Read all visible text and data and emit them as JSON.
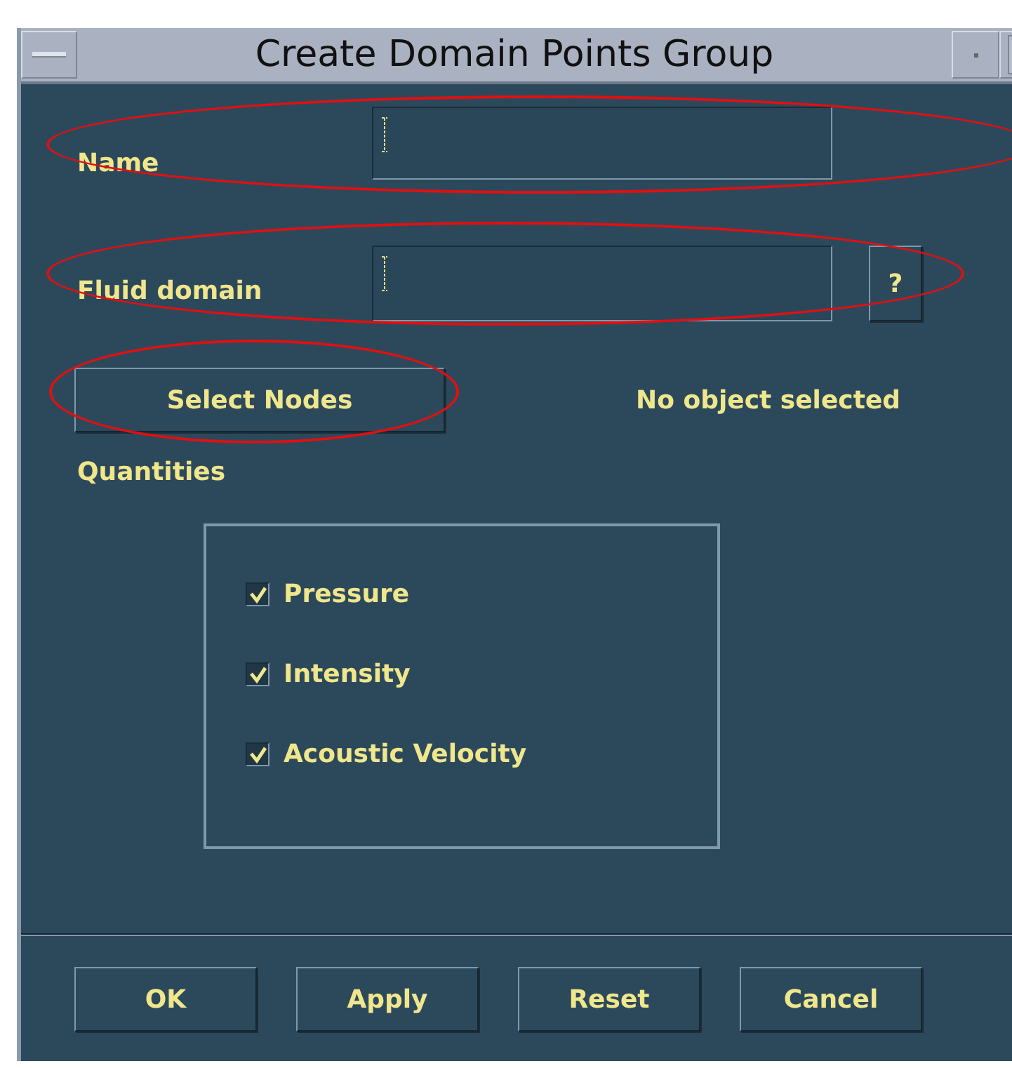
{
  "window": {
    "title": "Create Domain Points Group"
  },
  "name_field": {
    "label": "Name",
    "highlighted": true
  },
  "fluid_domain_field": {
    "label": "Fluid domain",
    "button": "?",
    "highlighted": true
  },
  "select_nodes": {
    "label": "Select Nodes",
    "highlighted": true,
    "status": "No object selected"
  },
  "quantities": {
    "label": "Quantities",
    "items": [
      {
        "label": "Pressure",
        "checked": true
      },
      {
        "label": "Intensity",
        "checked": true
      },
      {
        "label": "Acoustic Velocity",
        "checked": true
      }
    ]
  },
  "buttons": [
    "OK",
    "Apply",
    "Reset",
    "Cancel"
  ]
}
